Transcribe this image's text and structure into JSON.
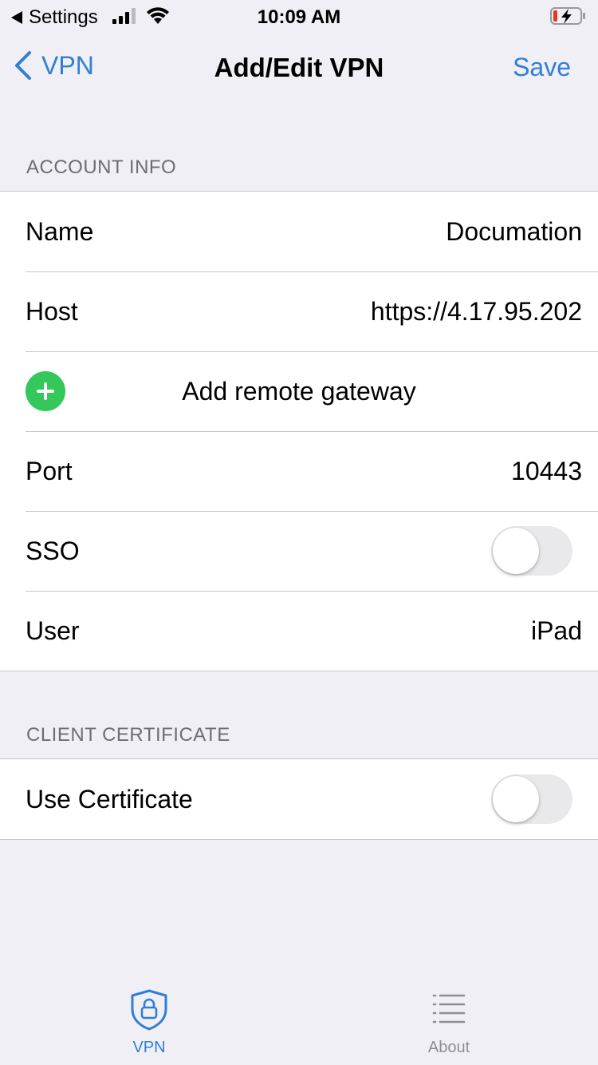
{
  "status_bar": {
    "back_label": "Settings",
    "time": "10:09 AM",
    "battery_state": "charging-low"
  },
  "nav": {
    "back_label": "VPN",
    "title": "Add/Edit VPN",
    "save_label": "Save"
  },
  "account_info": {
    "header": "ACCOUNT INFO",
    "name_label": "Name",
    "name_value": "Documation",
    "host_label": "Host",
    "host_value": "https://4.17.95.202",
    "add_gateway_label": "Add remote gateway",
    "port_label": "Port",
    "port_value": "10443",
    "sso_label": "SSO",
    "sso_enabled": false,
    "user_label": "User",
    "user_value": "iPad"
  },
  "client_certificate": {
    "header": "CLIENT CERTIFICATE",
    "use_cert_label": "Use Certificate",
    "use_cert_enabled": false
  },
  "tab_bar": {
    "tabs": [
      {
        "label": "VPN",
        "icon": "shield-lock-icon",
        "active": true
      },
      {
        "label": "About",
        "icon": "list-icon",
        "active": false
      }
    ]
  },
  "colors": {
    "accent": "#2f7fd6",
    "add_green": "#34c759",
    "background": "#f0eff5"
  }
}
